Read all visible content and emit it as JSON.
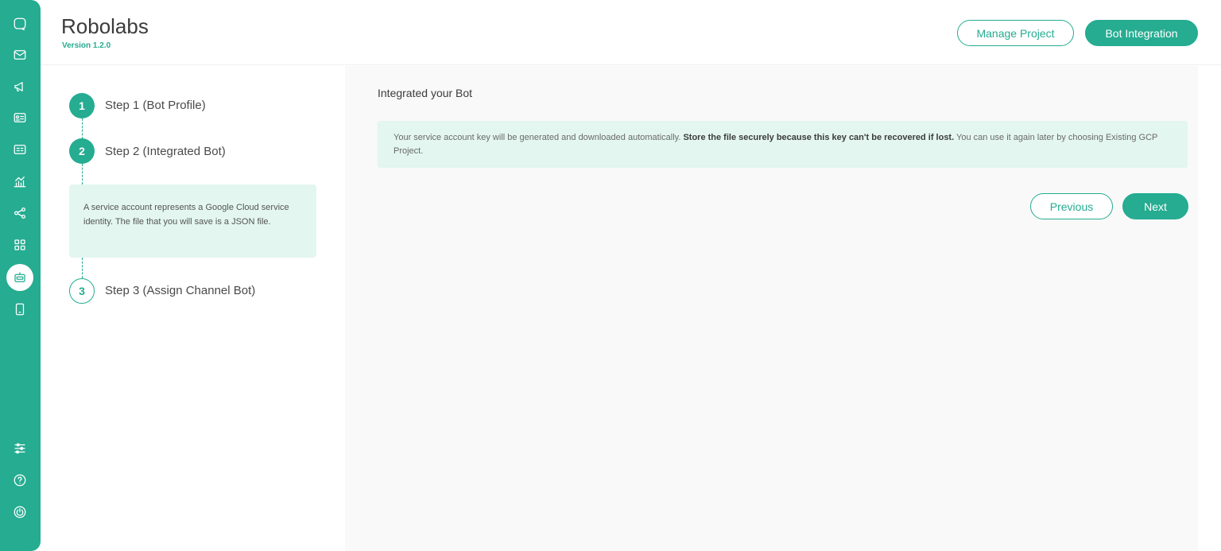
{
  "app": {
    "title": "Robolabs",
    "version": "Version 1.2.0"
  },
  "header": {
    "manage_project": "Manage Project",
    "bot_integration": "Bot Integration"
  },
  "sidebar": {
    "icons": [
      "chat-icon",
      "mail-icon",
      "megaphone-icon",
      "contact-card-icon",
      "id-card-icon",
      "analytics-icon",
      "share-nodes-icon",
      "grid-apps-icon",
      "bot-icon",
      "tablet-icon",
      "settings-sliders-icon",
      "help-icon",
      "power-icon"
    ],
    "active": "bot-icon"
  },
  "steps": [
    {
      "number": "1",
      "label": "Step 1 (Bot Profile)",
      "status": "done"
    },
    {
      "number": "2",
      "label": "Step 2 (Integrated Bot)",
      "status": "done"
    },
    {
      "number": "3",
      "label": "Step 3 (Assign Channel Bot)",
      "status": "todo"
    }
  ],
  "step_note": "A service account represents a Google Cloud service identity. The file that you will save is a JSON file.",
  "main": {
    "title": "Integrated your Bot",
    "info_prefix": "Your service account key will be generated and downloaded automatically. ",
    "info_bold": "Store the file securely because this key can't be recovered if lost.",
    "info_suffix": " You can use it again later by choosing Existing GCP Project.",
    "previous": "Previous",
    "next": "Next"
  },
  "colors": {
    "accent": "#25ac91",
    "note_bg": "#e3f6f0"
  }
}
